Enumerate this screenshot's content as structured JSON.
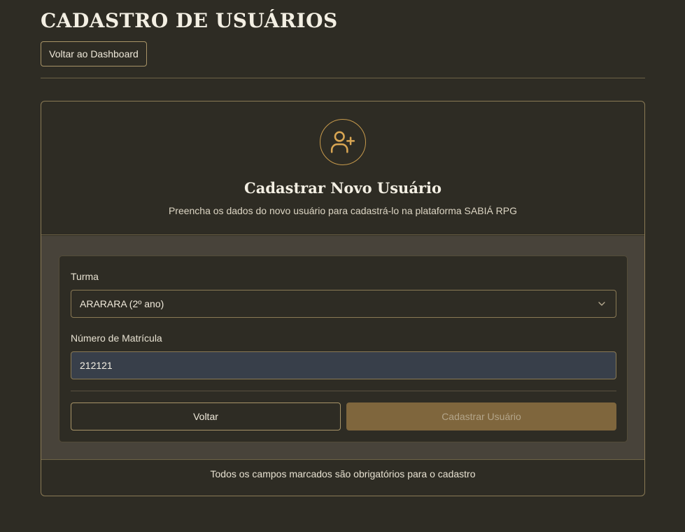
{
  "header": {
    "title": "CADASTRO DE USUÁRIOS",
    "back_dashboard_label": "Voltar ao Dashboard"
  },
  "card": {
    "icon": "user-plus-icon",
    "title": "Cadastrar Novo Usuário",
    "subtitle": "Preencha os dados do novo usuário para cadastrá-lo na plataforma SABIÁ RPG",
    "footer_note": "Todos os campos marcados são obrigatórios para o cadastro"
  },
  "form": {
    "class_field": {
      "label": "Turma",
      "selected_value": "ARARARA (2º ano)"
    },
    "enrollment_field": {
      "label": "Número de Matrícula",
      "value": "212121"
    },
    "back_label": "Voltar",
    "submit_label": "Cadastrar Usuário"
  },
  "colors": {
    "background": "#2e2c24",
    "accent_gold": "#c79a4c",
    "submit_button": "#7f663d",
    "input_fill": "#383f4a"
  }
}
